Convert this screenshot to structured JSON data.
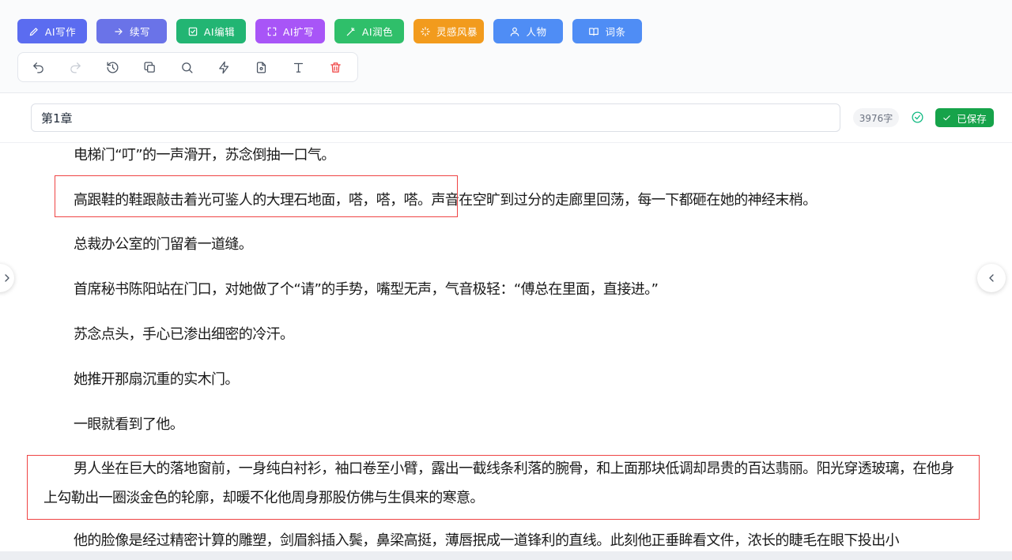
{
  "toolbar": {
    "ai_buttons": [
      {
        "label": "AI写作",
        "icon": "pen-icon",
        "color": "#5b6cf0"
      },
      {
        "label": "续写",
        "icon": "arrow-right-icon",
        "color": "#6a73e8"
      },
      {
        "label": "AI编辑",
        "icon": "edit-square-icon",
        "color": "#22b573"
      },
      {
        "label": "AI扩写",
        "icon": "expand-icon",
        "color": "#a855f7"
      },
      {
        "label": "AI润色",
        "icon": "magic-wand-icon",
        "color": "#2fbf6a"
      },
      {
        "label": "灵感风暴",
        "icon": "sparkle-icon",
        "color": "#f29b1d"
      },
      {
        "label": "人物",
        "icon": "user-icon",
        "color": "#4f8df5"
      },
      {
        "label": "词条",
        "icon": "book-icon",
        "color": "#4f8df5"
      }
    ],
    "tools": [
      "undo-icon",
      "redo-icon",
      "history-icon",
      "copy-icon",
      "search-icon",
      "lightning-icon",
      "file-icon",
      "text-format-icon",
      "trash-icon"
    ]
  },
  "chapter": {
    "title": "第1章",
    "word_count": "3976字",
    "saved_label": "已保存"
  },
  "content": {
    "paragraphs": [
      "电梯门“叮”的一声滑开，苏念倒抽一口气。",
      "高跟鞋的鞋跟敲击着光可鉴人的大理石地面，嗒，嗒，嗒。声音在空旷到过分的走廊里回荡，每一下都砸在她的神经末梢。",
      "总裁办公室的门留着一道缝。",
      "首席秘书陈阳站在门口，对她做了个“请”的手势，嘴型无声，气音极轻：“傅总在里面，直接进。”",
      "苏念点头，手心已渗出细密的冷汗。",
      "她推开那扇沉重的实木门。",
      "一眼就看到了他。",
      "男人坐在巨大的落地窗前，一身纯白衬衫，袖口卷至小臂，露出一截线条利落的腕骨，和上面那块低调却昂贵的百达翡丽。阳光穿透玻璃，在他身上勾勒出一圈淡金色的轮廓，却暖不化他周身那股仿佛与生俱来的寒意。",
      "他的脸像是经过精密计算的雕塑，剑眉斜插入鬓，鼻梁高挺，薄唇抿成一道锋利的直线。此刻他正垂眸看文件，浓长的睫毛在眼下投出小"
    ]
  },
  "colors": {
    "highlight_border": "#ef4444",
    "saved_badge": "#16a34a",
    "check": "#10b981"
  }
}
